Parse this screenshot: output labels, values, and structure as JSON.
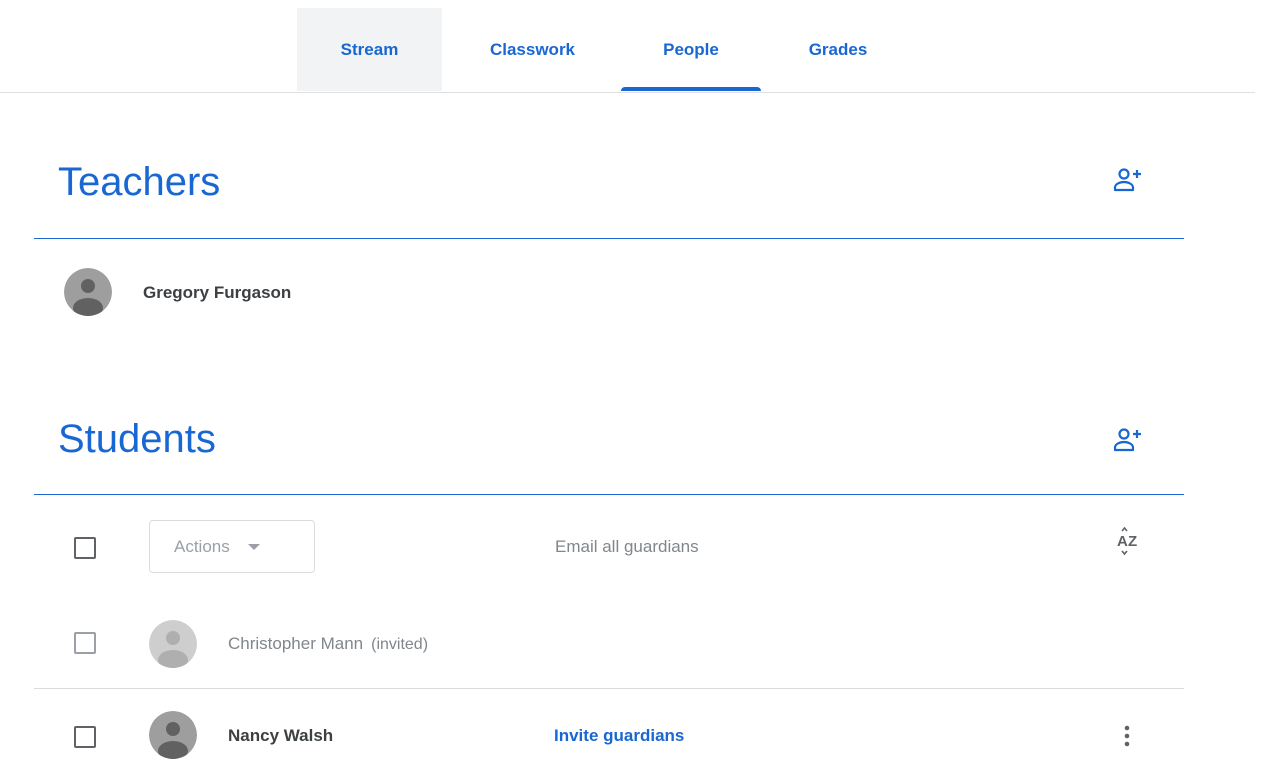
{
  "tabs": {
    "stream": "Stream",
    "classwork": "Classwork",
    "people": "People",
    "grades": "Grades"
  },
  "active_tab": "People",
  "teachers": {
    "title": "Teachers",
    "add_icon": "person-add-icon",
    "list": [
      {
        "name": "Gregory Furgason"
      }
    ]
  },
  "students": {
    "title": "Students",
    "add_icon": "person-add-icon",
    "toolbar": {
      "actions_label": "Actions",
      "email_all_label": "Email all guardians",
      "sort_icon": "sort-az-icon"
    },
    "list": [
      {
        "name": "Christopher Mann",
        "status": "(invited)"
      },
      {
        "name": "Nancy Walsh",
        "guardian_action": "Invite guardians",
        "menu_icon": "more-vert-icon"
      }
    ]
  },
  "colors": {
    "accent": "#1967d2",
    "text": "#3c4043",
    "muted": "#80868b"
  }
}
